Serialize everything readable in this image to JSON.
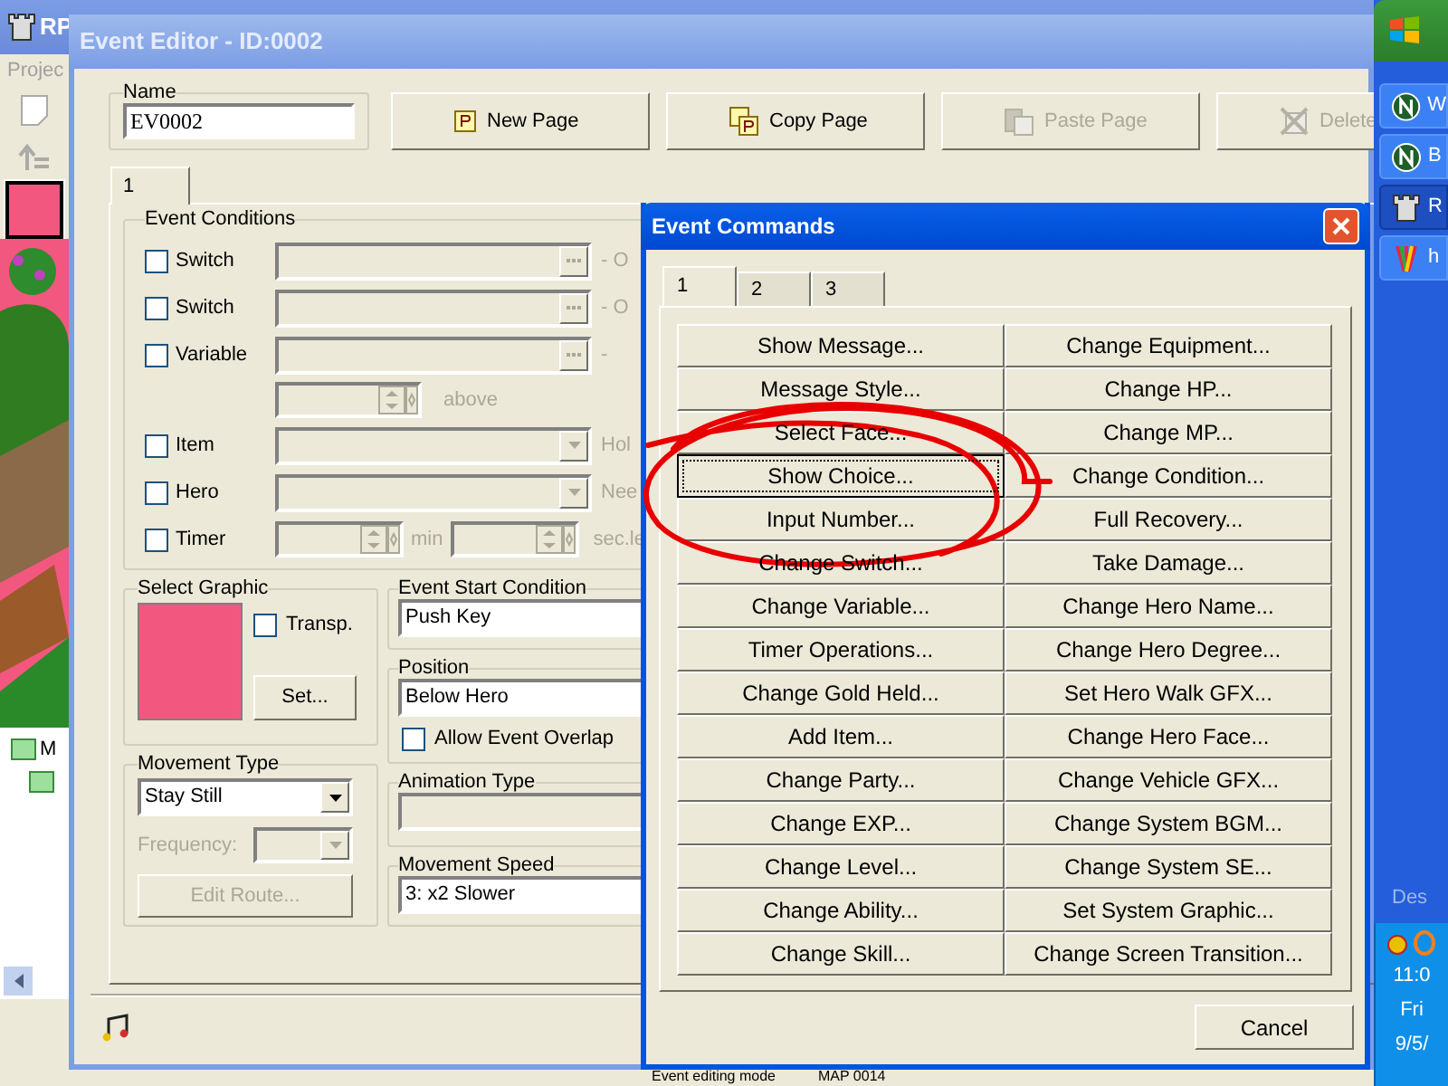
{
  "main_window": {
    "title": "RP",
    "menu": [
      "Projec"
    ],
    "tree_item": "M",
    "status_bar": [
      "Event editing mode",
      "MAP 0014"
    ]
  },
  "event_editor": {
    "title": "Event Editor - ID:0002",
    "name": {
      "label": "Name",
      "value": "EV0002"
    },
    "page_buttons": [
      {
        "kind": "new",
        "label": "New Page",
        "disabled": false
      },
      {
        "kind": "copy",
        "label": "Copy Page",
        "disabled": false
      },
      {
        "kind": "paste",
        "label": "Paste Page",
        "disabled": true
      },
      {
        "kind": "delete",
        "label": "Delete",
        "disabled": true
      }
    ],
    "page_tabs": [
      {
        "label": "1",
        "selected": true
      }
    ],
    "event_conditions": {
      "title": "Event Conditions",
      "rows": [
        {
          "kind": "picker",
          "label": "Switch",
          "checked": false,
          "suffix": "- O"
        },
        {
          "kind": "picker",
          "label": "Switch",
          "checked": false,
          "suffix": "- O"
        },
        {
          "kind": "picker",
          "label": "Variable",
          "checked": false,
          "suffix": "-"
        },
        {
          "kind": "spin",
          "suffix": "above"
        },
        {
          "kind": "dropdown",
          "label": "Item",
          "checked": false,
          "suffix": "Hol"
        },
        {
          "kind": "dropdown",
          "label": "Hero",
          "checked": false,
          "suffix": "Nee"
        },
        {
          "kind": "timer",
          "label": "Timer",
          "checked": false,
          "unit_1": "min",
          "unit_2": "sec.le"
        }
      ]
    },
    "select_graphic": {
      "title": "Select Graphic",
      "transparent": {
        "label": "Transp.",
        "checked": false
      },
      "button": "Set..."
    },
    "movement_type": {
      "title": "Movement Type",
      "value": "Stay Still",
      "frequency_label": "Frequency:",
      "button": {
        "label": "Edit Route...",
        "disabled": true
      }
    },
    "start_condition": {
      "title": "Event Start Condition",
      "value": "Push Key"
    },
    "position": {
      "title": "Position",
      "value": "Below Hero",
      "overlap": {
        "label": "Allow Event Overlap",
        "checked": false
      }
    },
    "animation_type": {
      "title": "Animation Type"
    },
    "movement_speed": {
      "title": "Movement Speed",
      "value": "3: x2 Slower"
    }
  },
  "event_commands": {
    "title": "Event Commands",
    "tabs": [
      {
        "label": "1",
        "selected": true
      },
      {
        "label": "2",
        "selected": false
      },
      {
        "label": "3",
        "selected": false
      }
    ],
    "commands": [
      {
        "label": "Show Message...",
        "focused": false
      },
      {
        "label": "Change Equipment...",
        "focused": false
      },
      {
        "label": "Message Style...",
        "focused": false
      },
      {
        "label": "Change HP...",
        "focused": false
      },
      {
        "label": "Select Face...",
        "focused": false
      },
      {
        "label": "Change MP...",
        "focused": false
      },
      {
        "label": "Show Choice...",
        "focused": true
      },
      {
        "label": "Change Condition...",
        "focused": false
      },
      {
        "label": "Input Number...",
        "focused": false
      },
      {
        "label": "Full Recovery...",
        "focused": false
      },
      {
        "label": "Change Switch...",
        "focused": false
      },
      {
        "label": "Take Damage...",
        "focused": false
      },
      {
        "label": "Change Variable...",
        "focused": false
      },
      {
        "label": "Change Hero Name...",
        "focused": false
      },
      {
        "label": "Timer Operations...",
        "focused": false
      },
      {
        "label": "Change Hero Degree...",
        "focused": false
      },
      {
        "label": "Change Gold Held...",
        "focused": false
      },
      {
        "label": "Set Hero Walk GFX...",
        "focused": false
      },
      {
        "label": "Add Item...",
        "focused": false
      },
      {
        "label": "Change Hero Face...",
        "focused": false
      },
      {
        "label": "Change Party...",
        "focused": false
      },
      {
        "label": "Change Vehicle GFX...",
        "focused": false
      },
      {
        "label": "Change EXP...",
        "focused": false
      },
      {
        "label": "Change System BGM...",
        "focused": false
      },
      {
        "label": "Change Level...",
        "focused": false
      },
      {
        "label": "Change System SE...",
        "focused": false
      },
      {
        "label": "Change Ability...",
        "focused": false
      },
      {
        "label": "Set System Graphic...",
        "focused": false
      },
      {
        "label": "Change Skill...",
        "focused": false
      },
      {
        "label": "Change Screen Transition...",
        "focused": false
      }
    ],
    "cancel": "Cancel"
  },
  "taskbar": {
    "items": [
      {
        "kind": "globe",
        "label": "W",
        "selected": false
      },
      {
        "kind": "globe",
        "label": "B",
        "selected": false
      },
      {
        "kind": "castle",
        "label": "R",
        "selected": true
      },
      {
        "kind": "paint",
        "label": "h",
        "selected": false
      }
    ],
    "desktop_label": "Des",
    "clock": [
      "11:0",
      "Fri",
      "9/5/"
    ]
  }
}
